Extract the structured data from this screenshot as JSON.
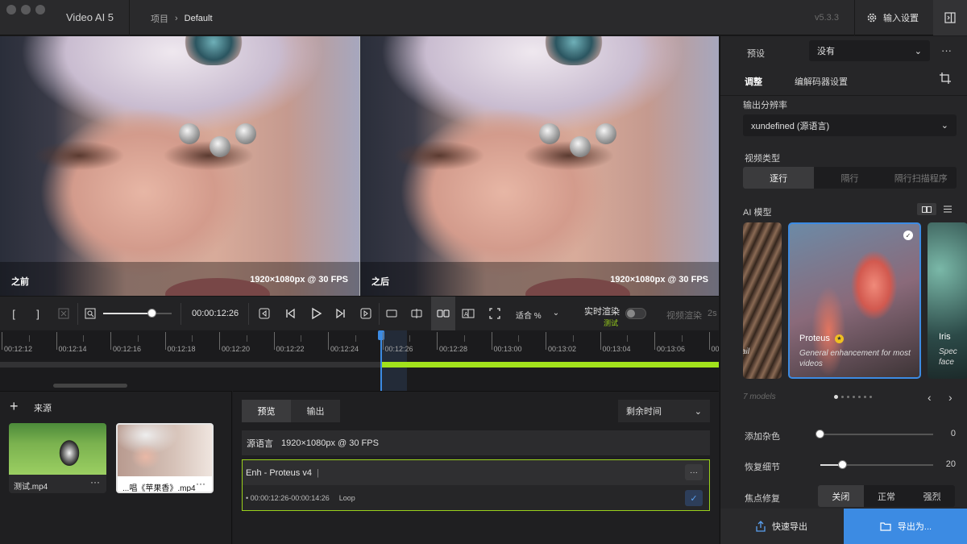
{
  "app": {
    "title": "Video AI  5",
    "breadcrumb": [
      "项目",
      "Default"
    ],
    "version": "v5.3.3",
    "input_settings": "输入设置"
  },
  "preview": {
    "before_label": "之前",
    "after_label": "之后",
    "before_res": "1920×1080px @ 30 FPS",
    "after_res": "1920×1080px @ 30 FPS"
  },
  "controls": {
    "timecode": "00:00:12:26",
    "zoom_level": 0.72,
    "fit_label": "适合",
    "fit_unit": "%",
    "realtime_label": "实时渲染",
    "realtime_sub": "测试",
    "video_render_label": "视频渲染",
    "video_render_time": "2s"
  },
  "timeline": {
    "labels": [
      "00:12:12",
      "00:12:14",
      "00:12:16",
      "00:12:18",
      "00:12:20",
      "00:12:22",
      "00:12:24",
      "00:12:26",
      "00:12:28",
      "00:13:00",
      "00:13:02",
      "00:13:04",
      "00:13:06",
      "00:1"
    ]
  },
  "source": {
    "title": "来源",
    "items": [
      {
        "name": "测试.mp4",
        "more": "···"
      },
      {
        "name": "...唱《苹果香》.mp4",
        "more": "···"
      }
    ]
  },
  "queue": {
    "tabs": [
      "预览",
      "输出"
    ],
    "remaining": "剩余时间",
    "source_label": "源语言",
    "source_res": "1920×1080px @ 30 FPS",
    "enhancement": "Enh - Proteus v4",
    "more": "···",
    "range": "00:00:12:26-00:00:14:26",
    "loop": "Loop"
  },
  "right_panel": {
    "preset_label": "预设",
    "preset_value": "没有",
    "tabs": [
      "调整",
      "编解码器设置"
    ],
    "output_res_label": "输出分辨率",
    "output_res_value": "xundefined (源语言)",
    "video_type_label": "视频类型",
    "video_types": [
      "逐行",
      "隔行",
      "隔行扫描程序"
    ],
    "ai_model_label": "AI 模型",
    "model_selected": {
      "name": "Proteus",
      "desc": "General enhancement for most videos"
    },
    "model_left_partial": "ail",
    "model_right_partial_name": "Iris",
    "model_right_partial_desc": "Spec face",
    "model_count": "7 models",
    "noise_label": "添加杂色",
    "noise_value": "0",
    "noise_level": 0,
    "detail_label": "恢复细节",
    "detail_value": "20",
    "detail_level": 0.2,
    "focus_label": "焦点修复",
    "focus_options": [
      "关闭",
      "正常",
      "强烈"
    ],
    "quick_export": "快速导出",
    "export_as": "导出为..."
  }
}
